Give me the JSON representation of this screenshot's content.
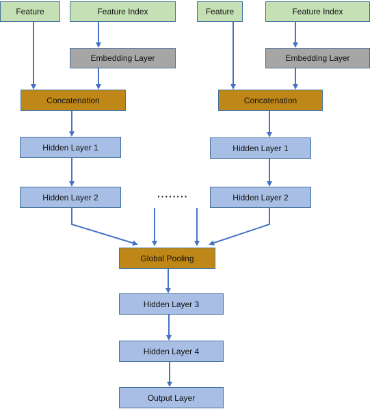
{
  "diagram": {
    "left_branch": {
      "feature": "Feature",
      "feature_index": "Feature Index",
      "embedding": "Embedding Layer",
      "concat": "Concatenation",
      "hidden1": "Hidden Layer 1",
      "hidden2": "Hidden Layer 2"
    },
    "right_branch": {
      "feature": "Feature",
      "feature_index": "Feature Index",
      "embedding": "Embedding Layer",
      "concat": "Concatenation",
      "hidden1": "Hidden Layer 1",
      "hidden2": "Hidden Layer 2"
    },
    "ellipsis": "········",
    "pooling": "Global Pooling",
    "hidden3": "Hidden Layer 3",
    "hidden4": "Hidden Layer 4",
    "output": "Output Layer"
  },
  "colors": {
    "input": "#c5e0b4",
    "embedding": "#a6a6a6",
    "merge": "#bf8717",
    "hidden": "#a9bee4",
    "border": "#41719c",
    "arrow": "#4472c4"
  }
}
